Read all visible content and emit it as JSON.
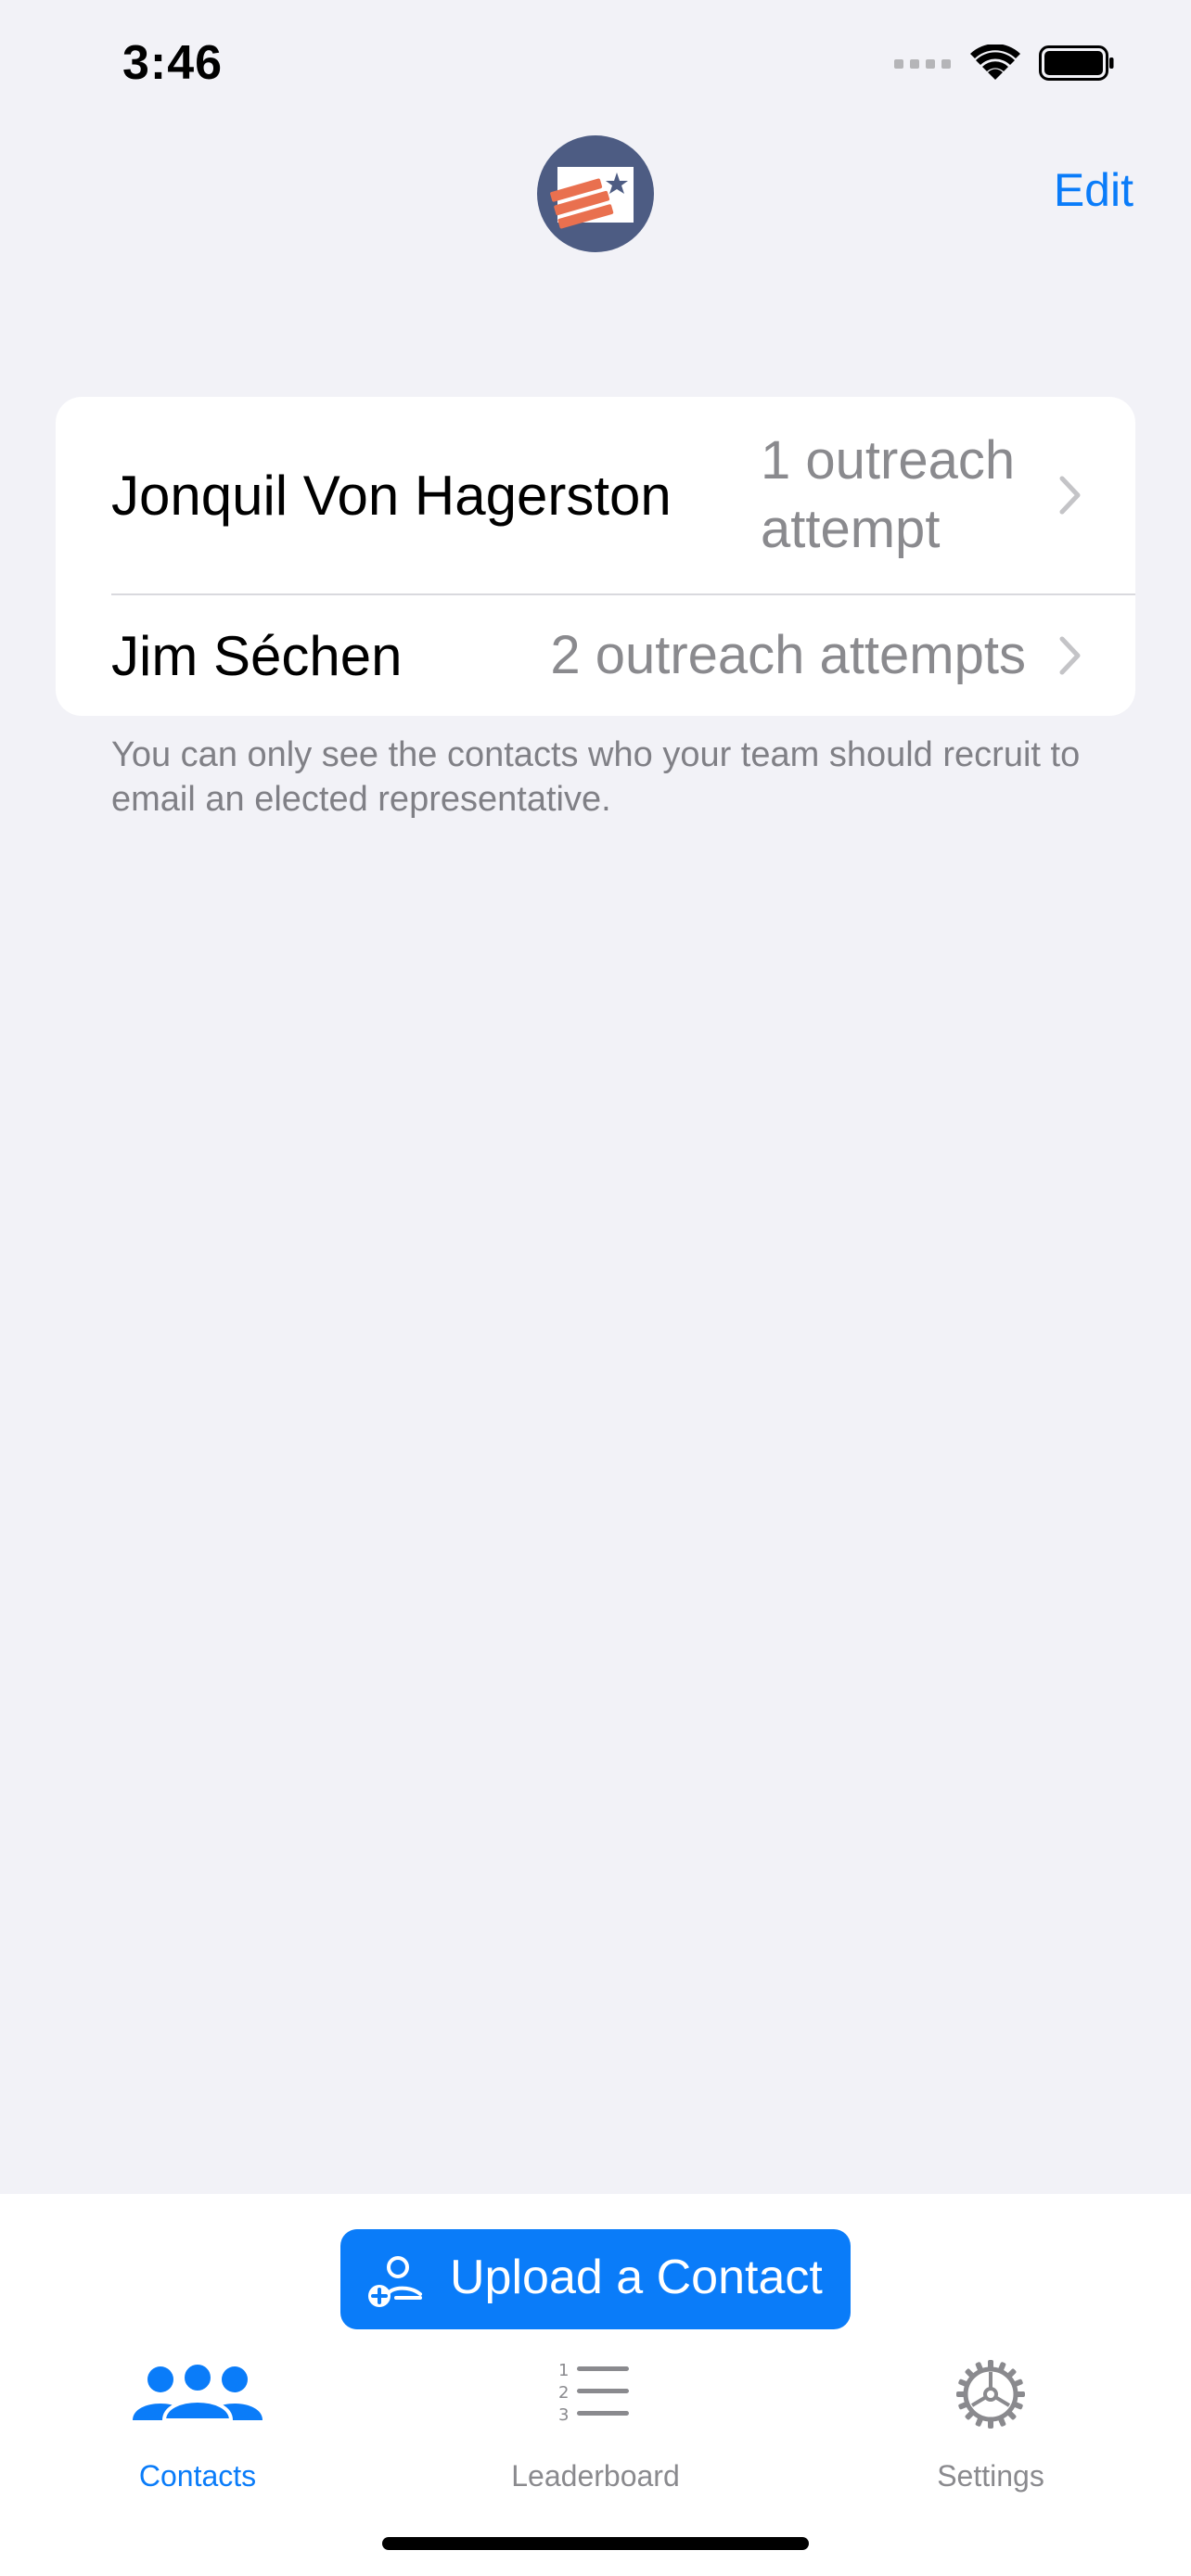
{
  "status_bar": {
    "time": "3:46"
  },
  "nav": {
    "edit_label": "Edit",
    "logo_icon": "flag-star-logo"
  },
  "contacts": [
    {
      "name": "Jonquil Von Hagerston",
      "detail": "1 outreach attempt"
    },
    {
      "name": "Jim Séchen",
      "detail": "2 outreach attempts"
    }
  ],
  "footer_note": "You can only see the contacts who your team should recruit to email an elected representative.",
  "upload_button": {
    "label": "Upload a Contact",
    "icon": "person-add-icon"
  },
  "tabs": [
    {
      "label": "Contacts",
      "icon": "people-icon",
      "active": true
    },
    {
      "label": "Leaderboard",
      "icon": "numbered-list-icon",
      "active": false
    },
    {
      "label": "Settings",
      "icon": "gear-icon",
      "active": false
    }
  ],
  "colors": {
    "accent": "#0A7CF9",
    "background": "#F2F2F7",
    "secondary_text": "#8A8A8E",
    "logo_bg": "#4D5C83",
    "logo_stripes": "#E9704F"
  }
}
